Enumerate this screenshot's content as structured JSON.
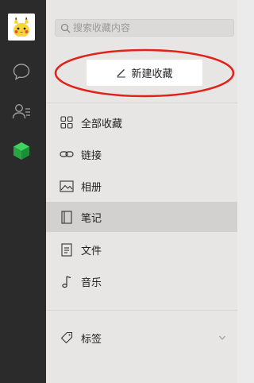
{
  "search": {
    "placeholder": "搜索收藏内容",
    "value": ""
  },
  "new_button": {
    "label": "新建收藏"
  },
  "categories": [
    {
      "label": "全部收藏",
      "icon": "grid-icon"
    },
    {
      "label": "链接",
      "icon": "link-icon"
    },
    {
      "label": "相册",
      "icon": "image-icon"
    },
    {
      "label": "笔记",
      "icon": "notebook-icon",
      "selected": true
    },
    {
      "label": "文件",
      "icon": "document-icon"
    },
    {
      "label": "音乐",
      "icon": "music-note-icon"
    }
  ],
  "tags": {
    "label": "标签",
    "expanded": false
  },
  "colors": {
    "rail": "#2b2b2b",
    "panel": "#e8e6e5",
    "selected": "#d3d1d0",
    "favorites_active": "#2bb24c",
    "annotation": "#e0231a"
  }
}
